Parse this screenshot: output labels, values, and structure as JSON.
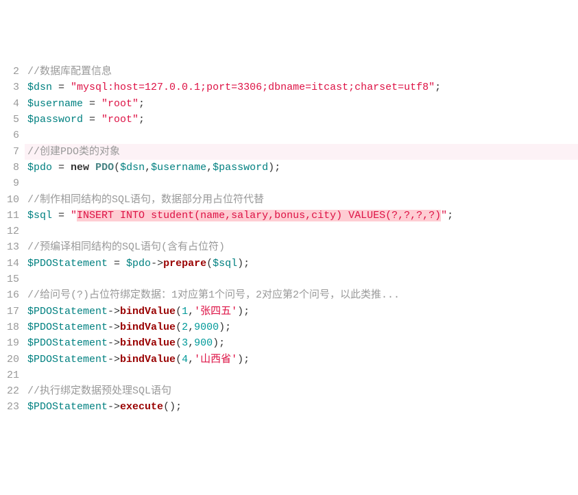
{
  "lineStart": 2,
  "lineEnd": 23,
  "highlightLine": 7,
  "code": {
    "l2": {
      "comment": "//数据库配置信息"
    },
    "l3": {
      "var": "$dsn",
      "eq": " = ",
      "str": "\"mysql:host=127.0.0.1;port=3306;dbname=itcast;charset=utf8\"",
      "semi": ";"
    },
    "l4": {
      "var": "$username",
      "eq": " = ",
      "str": "\"root\"",
      "semi": ";"
    },
    "l5": {
      "var": "$password",
      "eq": " = ",
      "str": "\"root\"",
      "semi": ";"
    },
    "l7": {
      "comment": "//创建PDO类的对象"
    },
    "l8": {
      "var": "$pdo",
      "eq": " = ",
      "kw": "new",
      "sp": " ",
      "cls": "PDO",
      "op": "(",
      "a1": "$dsn",
      "c1": ",",
      "a2": "$username",
      "c2": ",",
      "a3": "$password",
      "cp": ")",
      "semi": ";"
    },
    "l10": {
      "comment": "//制作相同结构的SQL语句，数据部分用占位符代替"
    },
    "l11": {
      "var": "$sql",
      "eq": " = ",
      "q1": "\"",
      "sel": "INSERT INTO student(name,salary,bonus,city) VALUES(?,?,?,?)",
      "q2": "\"",
      "semi": ";"
    },
    "l13": {
      "comment": "//预编译相同结构的SQL语句(含有占位符)"
    },
    "l14": {
      "var": "$PDOStatement",
      "eq": " = ",
      "v2": "$pdo",
      "ar": "->",
      "fn": "prepare",
      "op": "(",
      "a1": "$sql",
      "cp": ")",
      "semi": ";"
    },
    "l16": {
      "comment": "//给问号(?)占位符绑定数据：1对应第1个问号，2对应第2个问号，以此类推..."
    },
    "l17": {
      "var": "$PDOStatement",
      "ar": "->",
      "fn": "bindValue",
      "op": "(",
      "n": "1",
      "c": ",",
      "s": "'张四五'",
      "cp": ")",
      "semi": ";"
    },
    "l18": {
      "var": "$PDOStatement",
      "ar": "->",
      "fn": "bindValue",
      "op": "(",
      "n": "2",
      "c": ",",
      "n2": "9000",
      "cp": ")",
      "semi": ";"
    },
    "l19": {
      "var": "$PDOStatement",
      "ar": "->",
      "fn": "bindValue",
      "op": "(",
      "n": "3",
      "c": ",",
      "n2": "900",
      "cp": ")",
      "semi": ";"
    },
    "l20": {
      "var": "$PDOStatement",
      "ar": "->",
      "fn": "bindValue",
      "op": "(",
      "n": "4",
      "c": ",",
      "s": "'山西省'",
      "cp": ")",
      "semi": ";"
    },
    "l22": {
      "comment": "//执行绑定数据预处理SQL语句"
    },
    "l23": {
      "var": "$PDOStatement",
      "ar": "->",
      "fn": "execute",
      "op": "(",
      "cp": ")",
      "semi": ";"
    }
  }
}
